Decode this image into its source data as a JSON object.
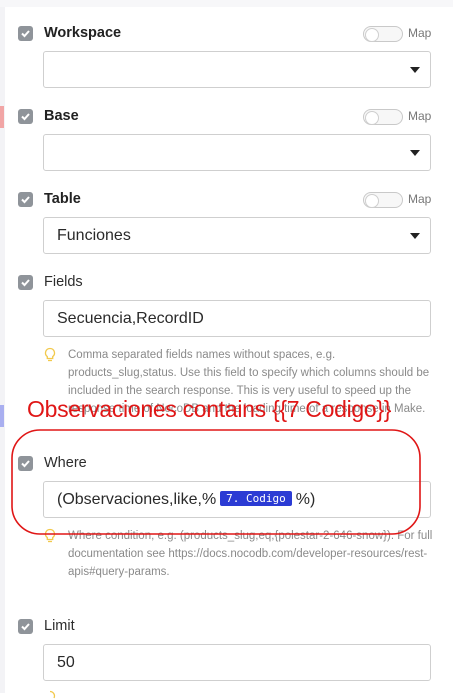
{
  "fields": {
    "workspace": {
      "label": "Workspace",
      "map_label": "Map",
      "value": ""
    },
    "base": {
      "label": "Base",
      "map_label": "Map",
      "value": ""
    },
    "table": {
      "label": "Table",
      "map_label": "Map",
      "value": "Funciones"
    },
    "fields": {
      "label": "Fields",
      "value": "Secuencia,RecordID",
      "hint": "Comma separated fields names without spaces, e.g. products_slug,status. Use this field to specify which columns should be included in the search response. This is very useful to speed up the response time of NocoDB and the loading time of a response in Make."
    },
    "where": {
      "label": "Where",
      "value_prefix": "(Observaciones,like,%",
      "chip": "7. Codigo",
      "value_suffix": "%)",
      "hint": "Where condition, e.g. (products_slug,eq,{polestar-2-646-snow}). For full documentation see https://docs.nocodb.com/developer-resources/rest-apis#query-params."
    },
    "limit": {
      "label": "Limit",
      "value": "50"
    }
  },
  "annotation": {
    "text": "Observaciones contains {{7 Codigo}}",
    "color": "#e01616"
  },
  "colors": {
    "chip_bg": "#2b3bd4",
    "checkbox": "#8f949a",
    "hint_bulb": "#f2c94c"
  }
}
